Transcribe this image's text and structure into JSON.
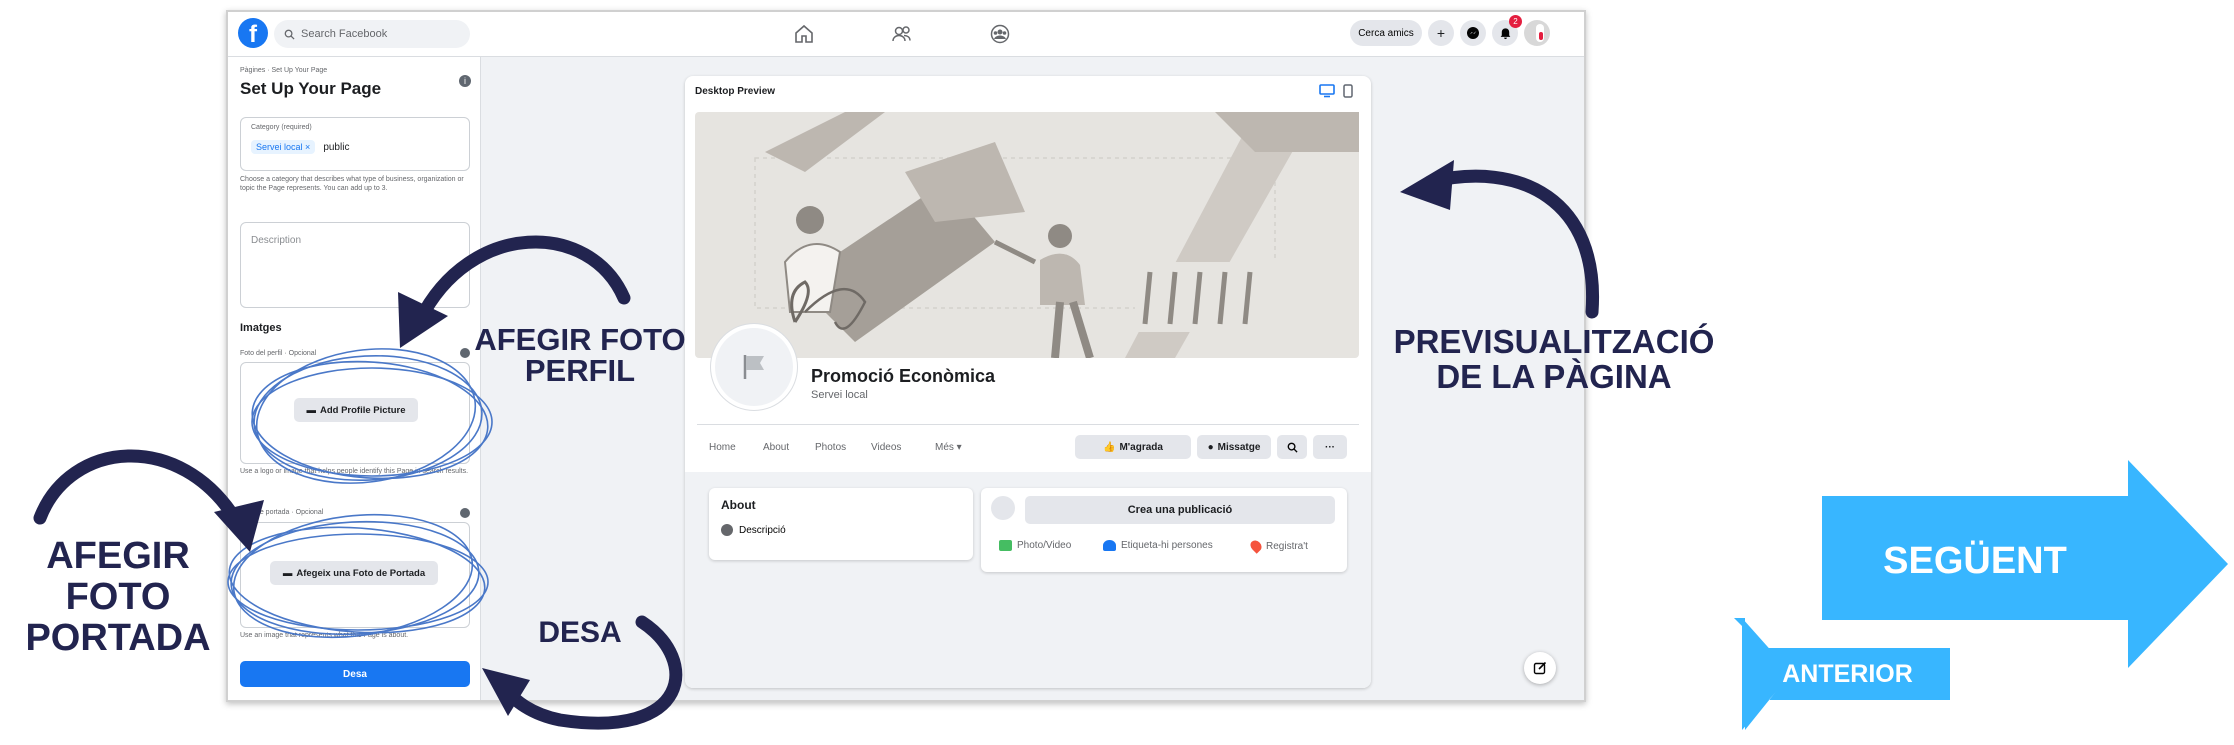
{
  "topbar": {
    "search_placeholder": "Search Facebook",
    "find_friends": "Cerca amics",
    "notifications_count": "2"
  },
  "panel": {
    "breadcrumb": "Pàgines · Set Up Your Page",
    "title": "Set Up Your Page",
    "category_label": "Category (required)",
    "category_chip": "Servei local",
    "category_input": "public",
    "category_help": "Choose a category that describes what type of business, organization or topic the Page represents. You can add up to 3.",
    "description_placeholder": "Description",
    "images_heading": "Imatges",
    "profile_label": "Foto del perfil · Opcional",
    "add_profile_button": "Add Profile Picture",
    "profile_help": "Use a logo or image that helps people identify this Page in search results.",
    "cover_label": "Foto de portada · Opcional",
    "add_cover_button": "Afegeix una Foto de Portada",
    "cover_help": "Use an image that represents what this Page is about.",
    "save_button": "Desa"
  },
  "preview": {
    "header": "Desktop Preview",
    "page_name": "Promoció Econòmica",
    "page_category": "Servei local",
    "tabs": [
      "Home",
      "About",
      "Photos",
      "Videos",
      "Més ▾"
    ],
    "like_button": "M'agrada",
    "message_button": "Missatge",
    "about_title": "About",
    "about_item": "Descripció",
    "create_post": "Crea una publicació",
    "post_actions": [
      "Photo/Video",
      "Etiqueta-hi persones",
      "Registra't"
    ]
  },
  "annotations": {
    "profile_line1": "AFEGIR FOTO",
    "profile_line2": "PERFIL",
    "preview_line1": "PREVISUALITZACIÓ",
    "preview_line2": "DE LA PÀGINA",
    "cover_line1": "AFEGIR",
    "cover_line2": "FOTO",
    "cover_line3": "PORTADA",
    "save": "DESA"
  },
  "navigation": {
    "next": "SEGÜENT",
    "previous": "ANTERIOR"
  },
  "colors": {
    "facebook_blue": "#1877f2",
    "annotation_navy": "#22244f",
    "nav_arrow_blue": "#38b6ff"
  }
}
